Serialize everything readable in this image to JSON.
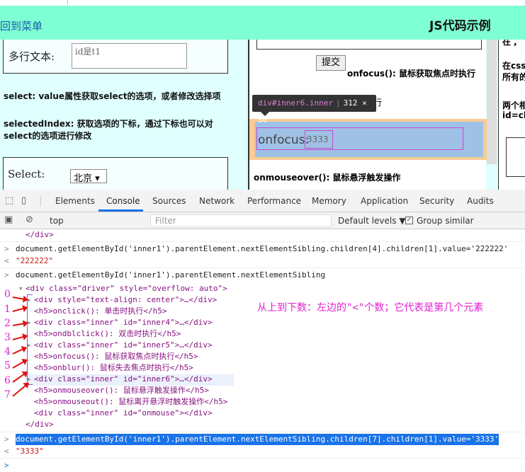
{
  "page": {
    "back_link": "回到菜单",
    "title": "JS代码示例",
    "textarea_label": "多行文本:",
    "textarea_value": "id是t1",
    "select_desc": "select: value属性获取select的选项，或者修改选择项",
    "selectedindex_desc_1": "selectedIndex: 获取选项的下标，通过下标也可以对",
    "selectedindex_desc_2": "select的选项进行修改",
    "select_label": "Select:",
    "select_value": "北京",
    "submit_label": "提交",
    "onfocus_desc": "onfocus(): 鼠标获取焦点时执行",
    "truncated_text": "行",
    "tooltip_selector": "div#inner6.inner",
    "tooltip_size": "312 × 50",
    "focus_label": "onfocus:",
    "focus_value": "3333",
    "hover_desc": "onmouseover(): 鼠标悬浮触发操作",
    "right_col": [
      "在 ,",
      "在css",
      "所有的",
      "两个相",
      "id=ch"
    ]
  },
  "devtools": {
    "tabs": [
      "Elements",
      "Console",
      "Sources",
      "Network",
      "Performance",
      "Memory",
      "Application",
      "Security",
      "Audits"
    ],
    "active_tab": "Console",
    "context": "top",
    "filter_placeholder": "Filter",
    "levels": "Default levels ▼",
    "group_similar": "Group similar"
  },
  "console": {
    "line0": "</div>",
    "cmd1": "document.getElementById('inner1').parentElement.nextElementSibling.children[4].children[1].value='222222'",
    "res1": "\"222222\"",
    "cmd2": "document.getElementById('inner1').parentElement.nextElementSibling",
    "tree": [
      "<div class=\"driver\" style=\"overflow: auto\">",
      "<div style=\"text-align: center\">…</div>",
      "<h5>onclick(): 单击时执行</h5>",
      "<div class=\"inner\" id=\"inner4\">…</div>",
      "<h5>ondblclick(): 双击时执行</h5>",
      "<div class=\"inner\" id=\"inner5\">…</div>",
      "<h5>onfocus(): 鼠标获取焦点时执行</h5>",
      "<h5>onblur(): 鼠标失去焦点时执行</h5>",
      "<div class=\"inner\" id=\"inner6\">…</div>",
      "<h5>onmouseover(): 鼠标悬浮触发操作</h5>",
      "<h5>onmouseout(): 鼠标离开悬浮时触发操作</h5>",
      "<div class=\"inner\" id=\"onmouse\"></div>",
      "</div>"
    ],
    "cmd3": "document.getElementById('inner1').parentElement.nextElementSibling.children[7].children[1].value='3333'",
    "res3": "\"3333\""
  },
  "annotation": {
    "numbers": [
      "0",
      "1",
      "2",
      "3",
      "4",
      "5",
      "6",
      "7"
    ],
    "note": "从上到下数：左边的\"<\"个数；它代表是第几个元素"
  },
  "colors": {
    "accent_bar": "#7fffd4",
    "page_bg": "#e0ffff",
    "annotation": "#e020d0",
    "arrow": "#e01010"
  }
}
